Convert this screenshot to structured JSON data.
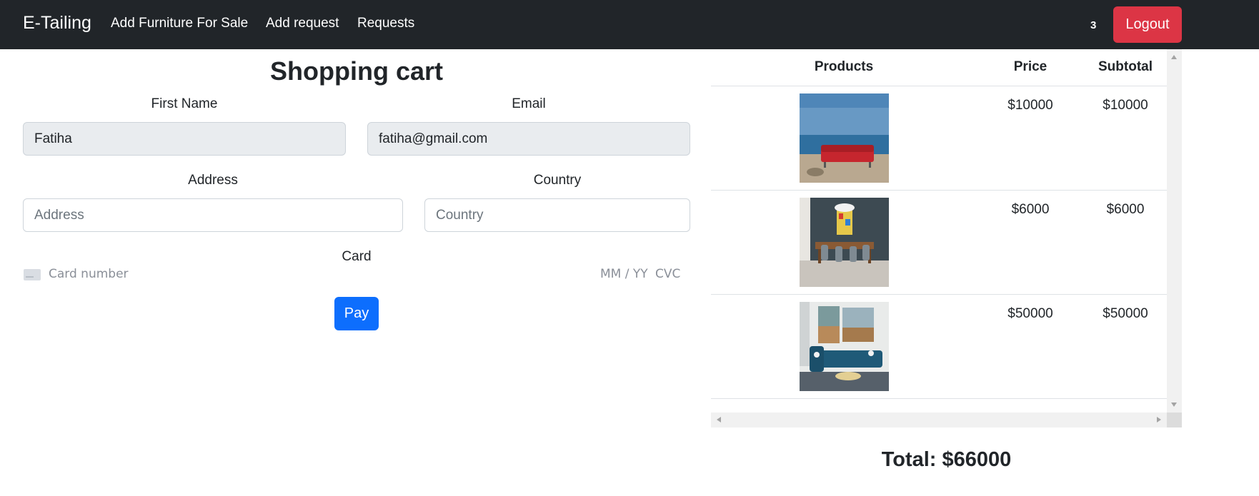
{
  "navbar": {
    "brand": "E-Tailing",
    "links": [
      "Add Furniture For Sale",
      "Add request",
      "Requests"
    ],
    "cart_count": "3",
    "logout_label": "Logout",
    "colors": {
      "background": "#212529",
      "logout": "#dc3545"
    }
  },
  "form": {
    "title": "Shopping cart",
    "first_name": {
      "label": "First Name",
      "value": "Fatiha"
    },
    "email": {
      "label": "Email",
      "value": "fatiha@gmail.com"
    },
    "address": {
      "label": "Address",
      "placeholder": "Address",
      "value": ""
    },
    "country": {
      "label": "Country",
      "placeholder": "Country",
      "value": ""
    },
    "card": {
      "label": "Card",
      "number_placeholder": "Card number",
      "expiry_placeholder": "MM / YY",
      "cvc_placeholder": "CVC"
    },
    "pay_label": "Pay",
    "colors": {
      "pay": "#0d6efd"
    }
  },
  "cart": {
    "headers": {
      "products": "Products",
      "price": "Price",
      "subtotal": "Subtotal"
    },
    "rows": [
      {
        "image": "red-sofa-on-beach",
        "price": "$10000",
        "subtotal": "$10000"
      },
      {
        "image": "dining-table-room",
        "price": "$6000",
        "subtotal": "$6000"
      },
      {
        "image": "blue-sectional-living-room",
        "price": "$50000",
        "subtotal": "$50000"
      }
    ],
    "total": "Total: $66000"
  }
}
